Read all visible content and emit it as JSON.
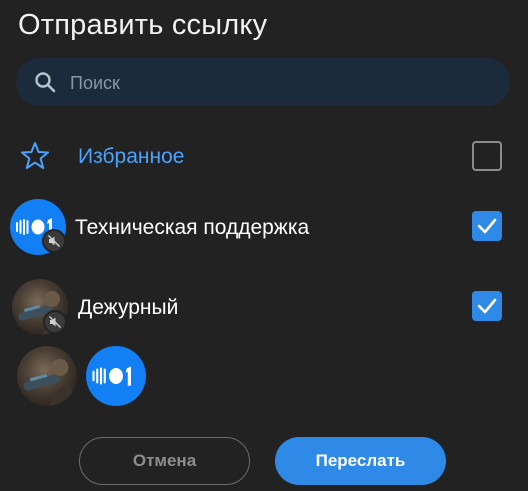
{
  "dialog": {
    "title": "Отправить ссылку",
    "search": {
      "placeholder": "Поиск",
      "value": ""
    },
    "favorites": {
      "label": "Избранное",
      "checked": false,
      "icon": "star-icon"
    },
    "contacts": [
      {
        "name": "Техническая поддержка",
        "checked": true,
        "avatar": "blue-logo-avatar",
        "muted": true
      },
      {
        "name": "Дежурный",
        "checked": true,
        "avatar": "photo-avatar",
        "muted": true
      }
    ],
    "selected_avatars": [
      "photo-avatar",
      "blue-logo-avatar"
    ],
    "buttons": {
      "cancel": "Отмена",
      "send": "Переслать"
    }
  },
  "colors": {
    "background": "#222222",
    "accent": "#2e8ae6",
    "favorites_text": "#4aa3ff",
    "search_bg": "#1c2b3b",
    "brand_blue": "#137ff5"
  }
}
